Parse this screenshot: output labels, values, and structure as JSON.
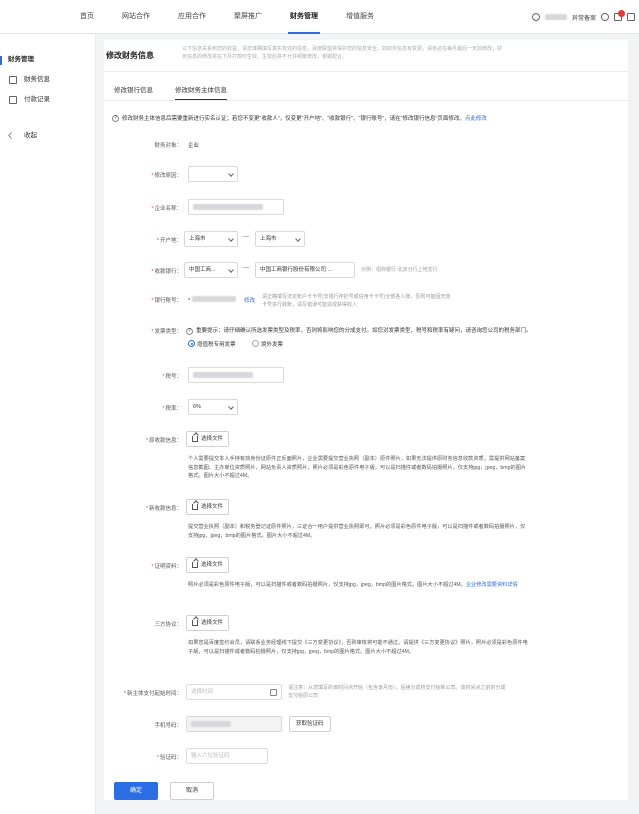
{
  "topnav": {
    "items": [
      {
        "label": "首页",
        "active": false
      },
      {
        "label": "网站合作",
        "active": false
      },
      {
        "label": "应用合作",
        "active": false
      },
      {
        "label": "聚屏推广",
        "active": false
      },
      {
        "label": "财务管理",
        "active": true
      },
      {
        "label": "增值服务",
        "active": false
      }
    ],
    "status_label": "异常备案"
  },
  "sidebar": {
    "group_label": "财务管理",
    "items": [
      {
        "label": "财务信息",
        "icon": "finance-info-icon"
      },
      {
        "label": "付款记录",
        "icon": "payment-record-icon"
      }
    ],
    "collapse_label": "收起"
  },
  "page": {
    "title": "修改财务信息",
    "description": "以下信息关系到您的收益，请您准确填写真实有效的信息，百度联盟将保护您的信息安全。如财务信息有变更，请务必在每月最后一天前修改；财务信息的修改将在下月打款时生效。生效后将不允许频繁修改，谢谢配合。"
  },
  "tabs": [
    {
      "label": "修改银行信息",
      "active": false
    },
    {
      "label": "修改财务主体信息",
      "active": true
    }
  ],
  "notice": {
    "text": "修改财务主体信息后需要重新进行实名认证；若您不变更“收款人”，仅变更“开户地”、“收款银行”、“银行账号”，请在“修改银行信息”页面修改。",
    "link": "点此修改"
  },
  "form": {
    "finance_object": {
      "label": "财务对象：",
      "value": "企业"
    },
    "change_reason": {
      "label": "修改原因：",
      "value": ""
    },
    "company_name": {
      "label": "企业名称："
    },
    "bank_location": {
      "label": "开户地：",
      "province": "上海市",
      "city": "上海市",
      "separator": "—"
    },
    "bank": {
      "label": "收款银行：",
      "bank": "中国工商...",
      "branch": "中国工商银行股份有限公司 ...",
      "hint": "示例：招商银行-北京分行上地支行"
    },
    "account": {
      "label": "银行账号：",
      "prefix": "*",
      "edit_link": "修改",
      "hint": "请正确填写法定账户卡卡号(支银行存折号或信用卡卡号)全部各人账，否则可能因无效卡号进行转账，请写错误可能造成获得收入"
    },
    "invoice_type": {
      "label": "发票类型：",
      "tip": "重要提示：请仔细确认所选发票类型及税率，否则将影响您的分成支付。如您对发票类型、税号和税率有疑问，请咨询您公司的税务部门。",
      "options": [
        {
          "label": "增值税专用发票",
          "checked": true
        },
        {
          "label": "境外发票",
          "checked": false
        }
      ]
    },
    "tax_number": {
      "label": "税号："
    },
    "tax_rate": {
      "label": "税率：",
      "value": "6%"
    },
    "original_proof": {
      "label": "原收款信息：",
      "button": "选择文件",
      "description": "个人需要提交本人手持有效身份证原件正反面照片，企业需要提交营业执照（副本）原件照片，如果无法提供原财务信息收款资质，需提供网站备案信息截图、主办单位资质照片、网站负责人资质照片，照片必须是彩色原件电子版，可以是扫描件或者数码拍摄照片，仅支持jpg，jpeg，bmp的图片格式。图片大小不超过4M。"
    },
    "new_proof": {
      "label": "新收款信息：",
      "button": "选择文件",
      "description": "提交营业执照（副本）和税务登记证原件照片，三证合一用户提供营业执照即可。照片必须是彩色原件电子版，可以是扫描件或者数码拍摄照片，仅支持jpg，jpeg，bmp的图片格式。图片大小不超过4M。"
    },
    "certificate": {
      "label": "证明资料：",
      "button": "选择文件",
      "description": "照片必须是彩色原件电子版，可以是扫描件或者数码拍摄照片，仅支持jpg，jpeg，bmp的图片格式。图片大小不超过4M。",
      "link": "企业修改需要资料详情"
    },
    "tripartite": {
      "label": "三方协议：",
      "button": "选择文件",
      "description": "如果您是百度签约会员，请联系业务经理线下提交《三方变更协议》，否则审核将可能不通过。请提供《三方变更协议》照片，照片必须是彩色原件电子版，可以是扫描件或者数码拍摄照片，仅支持jpg，jpeg，bmp的图片格式。图片大小不超过4M。"
    },
    "start_time": {
      "label": "新主体支付起始时间：",
      "placeholder": "选择时间",
      "hint": "请注意：从您填写的该时间点开始（包含该月份），后续分成将支付给新公司。该时间点之前的分成支付给原公司"
    },
    "phone": {
      "label": "手机号码：",
      "code_button": "获取验证码"
    },
    "verify_code": {
      "label": "验证码：",
      "placeholder": "输入六位验证码"
    }
  },
  "actions": {
    "confirm": "确定",
    "cancel": "取消"
  },
  "colors": {
    "accent": "#2b6de5",
    "required": "#e53935",
    "badge": "#e53935"
  }
}
